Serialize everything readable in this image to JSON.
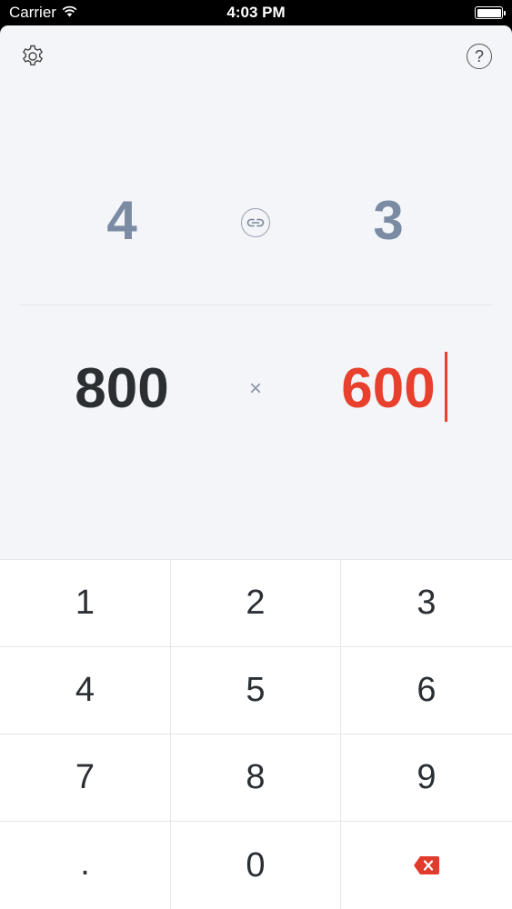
{
  "status_bar": {
    "carrier": "Carrier",
    "time": "4:03 PM",
    "battery_level": 1.0
  },
  "toolbar": {
    "settings_icon": "gear-icon",
    "help_icon": "question-mark-icon",
    "help_glyph": "?"
  },
  "ratio": {
    "left": "4",
    "right": "3",
    "link_icon": "link-icon"
  },
  "dimensions": {
    "width": "800",
    "separator": "×",
    "height": "600",
    "active_field": "height"
  },
  "keypad": {
    "keys": [
      "1",
      "2",
      "3",
      "4",
      "5",
      "6",
      "7",
      "8",
      "9",
      ".",
      "0"
    ],
    "delete_icon": "backspace-icon"
  },
  "colors": {
    "background": "#f3f5f8",
    "ratio_text": "#7a8ba3",
    "value_text": "#2b2f33",
    "active_value": "#e8402d",
    "delete_key": "#e23b2e"
  }
}
